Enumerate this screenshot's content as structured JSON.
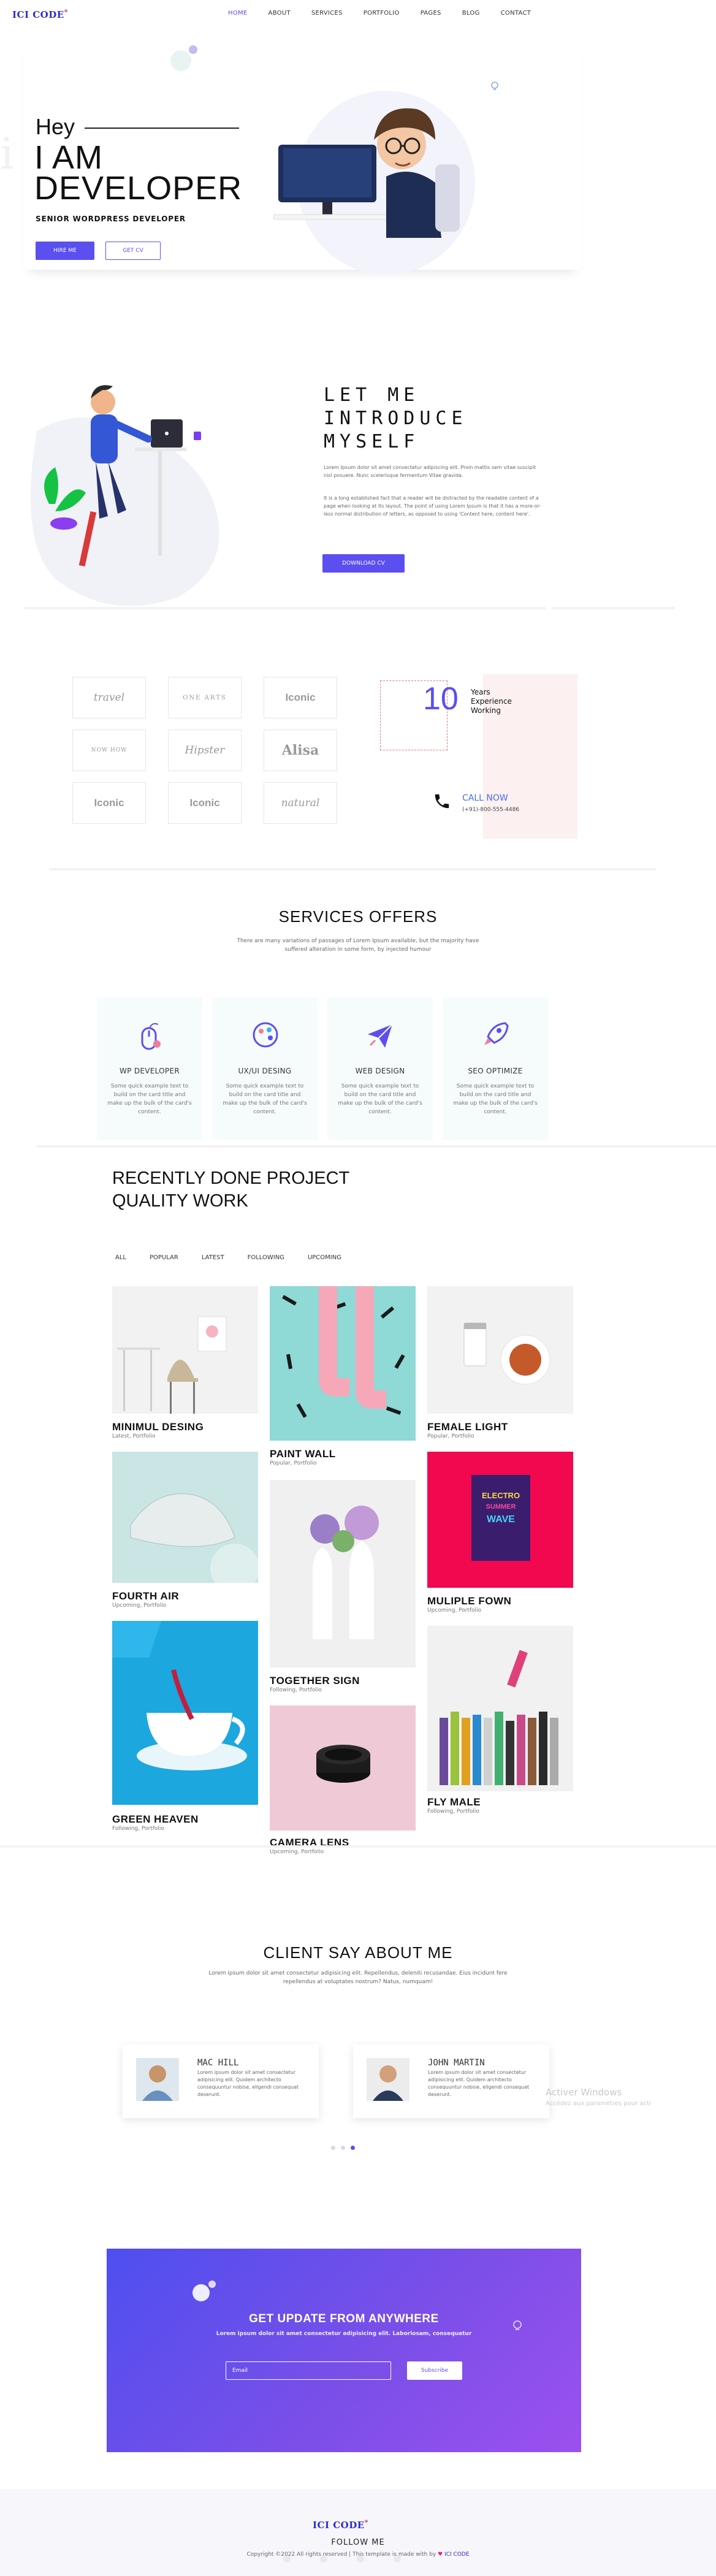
{
  "nav": {
    "logo_text": "ICI CODE",
    "logo_mark": "*",
    "links": [
      "HOME",
      "ABOUT",
      "SERVICES",
      "PORTFOLIO",
      "PAGES",
      "BLOG",
      "CONTACT"
    ],
    "active": "HOME",
    "accent": "#5b4ff0"
  },
  "hero": {
    "greeting": "Hey",
    "headline_1": "I AM",
    "headline_2": "DEVELOPER",
    "subtitle": "SENIOR WORDPRESS DEVELOPER",
    "btn_hire": "HIRE ME",
    "btn_cv": "GET CV"
  },
  "about": {
    "title_1": "LET ME",
    "title_2": "INTRODUCE",
    "title_3": "MYSELF",
    "para_1": "Lorem Ipsum dolor sit amet consectetur adipiscing elit. Proin mattis sem vitae suscipit nisl posuere. Nunc scelerisque fermentum Vitae gravida.",
    "para_2": "It is a long established fact that a reader will be distracted by the readable content of a page when looking at its layout. The point of using Lorem Ipsum is that it has a more-or-less normal distribution of letters, as opposed to using 'Content here, content here'.",
    "download_btn": "DOWNLOAD CV"
  },
  "brands": {
    "logos": [
      "travel",
      "ONE ARTS",
      "Iconic",
      "NOW HOW",
      "Hipster",
      "Alisa",
      "Iconic",
      "Iconic",
      "natural"
    ]
  },
  "experience": {
    "years": "10",
    "label_1": "Years",
    "label_2": "Experience",
    "label_3": "Working",
    "call_label": "CALL NOW",
    "phone": "(+91)-800-555-4486"
  },
  "services": {
    "title": "SERVICES OFFERS",
    "subtitle_1": "There are many variations of passages of Lorem Ipsum available, but the majority have",
    "subtitle_2": "suffered alteration in some form, by injected humour",
    "items": [
      {
        "title": "WP DEVELOPER",
        "icon": "mouse-icon",
        "desc": "Some quick example text to build on the card title and make up the bulk of the card's content."
      },
      {
        "title": "UX/UI DESING",
        "icon": "palette-icon",
        "desc": "Some quick example text to build on the card title and make up the bulk of the card's content."
      },
      {
        "title": "WEB DESIGN",
        "icon": "paper-plane-icon",
        "desc": "Some quick example text to build on the card title and make up the bulk of the card's content."
      },
      {
        "title": "SEO OPTIMIZE",
        "icon": "rocket-icon",
        "desc": "Some quick example text to build on the card title and make up the bulk of the card's content."
      }
    ]
  },
  "portfolio": {
    "title_1": "RECENTLY DONE PROJECT",
    "title_2": "QUALITY WORK",
    "filters": [
      "ALL",
      "POPULAR",
      "LATEST",
      "FOLLOWING",
      "UPCOMING"
    ],
    "projects": [
      {
        "title": "MINIMUL DESING",
        "cat": "Latest, Portfolio"
      },
      {
        "title": "PAINT WALL",
        "cat": "Popular, Portfolio"
      },
      {
        "title": "FEMALE LIGHT",
        "cat": "Popular, Portfolio"
      },
      {
        "title": "FOURTH AIR",
        "cat": "Upcoming, Portfolio"
      },
      {
        "title": "TOGETHER SIGN",
        "cat": "Following, Portfolio"
      },
      {
        "title": "MULIPLE FOWN",
        "cat": "Upcoming, Portfolio"
      },
      {
        "title": "GREEN HEAVEN",
        "cat": "Following, Portfolio"
      },
      {
        "title": "CAMERA LENS",
        "cat": "Upcoming, Portfolio"
      },
      {
        "title": "FLY MALE",
        "cat": "Following, Portfolio"
      }
    ],
    "book_text_1": "ELECTRO",
    "book_text_2": "SUMMER",
    "book_text_3": "WAVE"
  },
  "clients": {
    "title": "CLIENT SAY ABOUT ME",
    "subtitle_1": "Lorem ipsum dolor sit amet consectetur adipisicing elit. Repellendus, deleniti recusandae. Eius incidunt fere",
    "subtitle_2": "repellendus at voluptates nostrum? Natus, numquam!",
    "testimonials": [
      {
        "name": "MAC HILL",
        "text": "Lorem ipsum dolor sit amet consectetur adipisicing elit. Quidem architecto consequuntur nobise, eligendi consequat deserunt."
      },
      {
        "name": "JOHN MARTIN",
        "text": "Lorem ipsum dolor sit amet consectetur adipisicing elit. Quidem architecto consequuntur nobise, eligendi consequat deserunt."
      }
    ],
    "watermark_1": "Activer Windows",
    "watermark_2": "Accédez aux paramètres pour acti"
  },
  "newsletter": {
    "title": "GET UPDATE FROM ANYWHERE",
    "subtitle": "Lorem ipsum dolor sit amet consectetur adipisicing elit. Laboriosam, consequatur",
    "email_placeholder": "Email",
    "btn": "Subscribe"
  },
  "footer": {
    "logo_text": "ICI CODE",
    "logo_mark": "*",
    "follow": "FOLLOW ME",
    "copyright": "Copyright ©2022 All rights reserved | This template is made with by",
    "copyright_brand": "ICI CODE"
  }
}
